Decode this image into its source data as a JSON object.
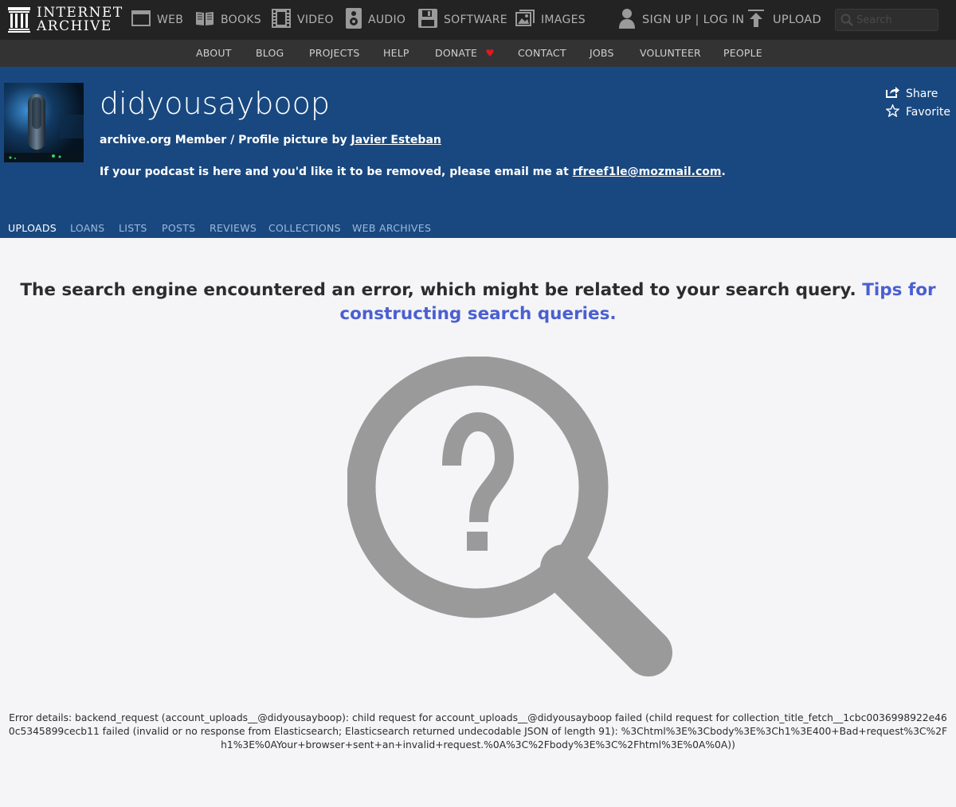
{
  "brand": {
    "line1": "INTERNET",
    "line2": "ARCHIVE"
  },
  "topnav": {
    "web": "WEB",
    "books": "BOOKS",
    "video": "VIDEO",
    "audio": "AUDIO",
    "software": "SOFTWARE",
    "images": "IMAGES",
    "signup_login": "SIGN UP | LOG IN",
    "upload": "UPLOAD",
    "search_placeholder": "Search"
  },
  "subnav": {
    "about": "ABOUT",
    "blog": "BLOG",
    "projects": "PROJECTS",
    "help": "HELP",
    "donate": "DONATE",
    "contact": "CONTACT",
    "jobs": "JOBS",
    "volunteer": "VOLUNTEER",
    "people": "PEOPLE"
  },
  "profile": {
    "username": "didyousayboop",
    "meta_prefix": "archive.org Member / Profile picture by ",
    "photo_credit": "Javier Esteban",
    "desc_prefix": "If your podcast is here and you'd like it to be removed, please email me at ",
    "email": "rfreef1le@mozmail.com",
    "desc_suffix": ".",
    "share": "Share",
    "favorite": "Favorite"
  },
  "tabs": {
    "uploads": "UPLOADS",
    "loans": "LOANS",
    "lists": "LISTS",
    "posts": "POSTS",
    "reviews": "REVIEWS",
    "collections": "COLLECTIONS",
    "web_archives": "WEB ARCHIVES",
    "active": "uploads"
  },
  "error": {
    "message": "The search engine encountered an error, which might be related to your search query.",
    "tips_link": "Tips for constructing search queries.",
    "details": "Error details: backend_request (account_uploads__@didyousayboop): child request for account_uploads__@didyousayboop failed (child request for collection_title_fetch__1cbc0036998922e460c5345899cecb11 failed (invalid or no response from Elasticsearch; Elasticsearch returned undecodable JSON of length 91): %3Chtml%3E%3Cbody%3E%3Ch1%3E400+Bad+request%3C%2Fh1%3E%0AYour+browser+sent+an+invalid+request.%0A%3C%2Fbody%3E%3C%2Fhtml%3E%0A%0A))"
  },
  "colors": {
    "topbar": "#232323",
    "subnav": "#333333",
    "header": "#194880",
    "link": "#4a5fd1",
    "magnifier": "#9a9a9a",
    "donate_heart": "#e0191e"
  },
  "icons": {
    "logo": "archive-building-icon",
    "web": "browser-window-icon",
    "books": "open-book-icon",
    "video": "film-strip-icon",
    "audio": "speaker-icon",
    "software": "floppy-disk-icon",
    "images": "picture-icon",
    "user": "user-icon",
    "upload": "upload-arrow-icon",
    "search": "search-icon",
    "share": "share-icon",
    "favorite": "star-icon",
    "empty_state": "magnifier-question-icon"
  }
}
